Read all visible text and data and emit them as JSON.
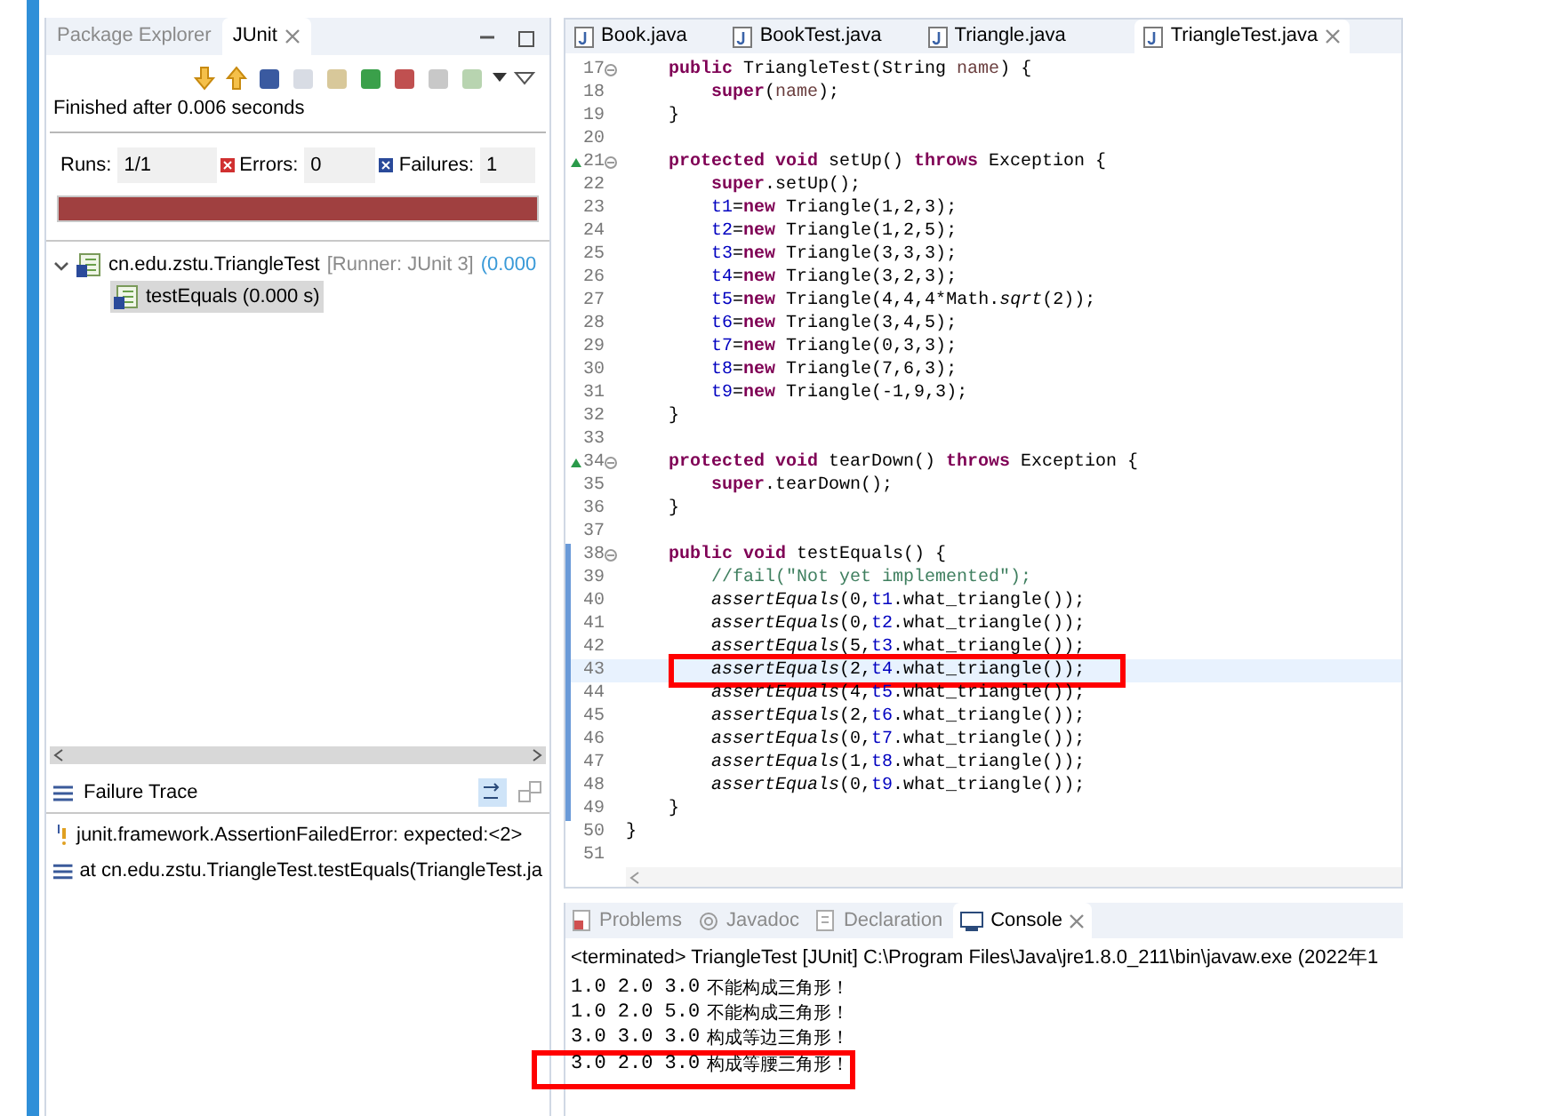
{
  "junit_view": {
    "tabs": [
      {
        "label": "Package Explorer",
        "selected": false
      },
      {
        "label": "JUnit",
        "selected": true
      }
    ],
    "status": "Finished after 0.006 seconds",
    "counters": [
      {
        "label": "Runs:",
        "value": "1/1",
        "kind": "runs"
      },
      {
        "label": "Errors:",
        "value": "0",
        "kind": "errors"
      },
      {
        "label": "Failures:",
        "value": "1",
        "kind": "failures"
      }
    ],
    "progress": {
      "level": 1,
      "failed": true
    },
    "tree": [
      {
        "label": "cn.edu.zstu.TriangleTest",
        "runner": "[Runner: JUnit 3]",
        "time": "(0.000",
        "expanded": true,
        "selected": false,
        "children": [
          {
            "label": "testEquals (0.000 s)",
            "selected": true
          }
        ]
      }
    ],
    "failure_trace": {
      "title": "Failure Trace",
      "lines": [
        {
          "kind": "error",
          "text": "junit.framework.AssertionFailedError: expected:<2>"
        },
        {
          "kind": "stack",
          "text": "at cn.edu.zstu.TriangleTest.testEquals(TriangleTest.ja"
        }
      ]
    }
  },
  "editor": {
    "tabs": [
      {
        "label": "Book.java",
        "selected": false
      },
      {
        "label": "BookTest.java",
        "selected": false
      },
      {
        "label": "Triangle.java",
        "selected": false
      },
      {
        "label": "TriangleTest.java",
        "selected": true
      }
    ],
    "class_body": [
      {
        "no": "17",
        "fold": true,
        "override": false,
        "changed": false,
        "current": false,
        "segs": [
          {
            "kind": "keyword",
            "text": "public"
          },
          {
            "kind": "plain",
            "text": " TriangleTest(String "
          },
          {
            "kind": "param",
            "text": "name"
          },
          {
            "kind": "plain",
            "text": ") {"
          }
        ],
        "children": [
          {
            "no": "18",
            "fold": false,
            "override": false,
            "changed": false,
            "current": false,
            "segs": [
              {
                "kind": "keyword",
                "text": "super"
              },
              {
                "kind": "plain",
                "text": "("
              },
              {
                "kind": "param",
                "text": "name"
              },
              {
                "kind": "plain",
                "text": ");"
              }
            ]
          }
        ]
      },
      {
        "no": "19",
        "fold": false,
        "override": false,
        "changed": false,
        "current": false,
        "segs": [
          {
            "kind": "plain",
            "text": "}"
          }
        ]
      },
      {
        "no": "20",
        "fold": false,
        "override": false,
        "changed": false,
        "current": false
      },
      {
        "no": "21",
        "fold": true,
        "override": true,
        "changed": false,
        "current": false,
        "segs": [
          {
            "kind": "keyword",
            "text": "protected void"
          },
          {
            "kind": "plain",
            "text": " setUp() "
          },
          {
            "kind": "keyword",
            "text": "throws"
          },
          {
            "kind": "plain",
            "text": " Exception {"
          }
        ],
        "children": [
          {
            "no": "22",
            "fold": false,
            "override": false,
            "changed": false,
            "current": false,
            "segs": [
              {
                "kind": "keyword",
                "text": "super"
              },
              {
                "kind": "plain",
                "text": ".setUp();"
              }
            ]
          },
          {
            "no": "23",
            "fold": false,
            "override": false,
            "changed": false,
            "current": false,
            "segs": [
              {
                "kind": "field",
                "text": "t1"
              },
              {
                "kind": "plain",
                "text": "="
              },
              {
                "kind": "keyword",
                "text": "new"
              },
              {
                "kind": "plain",
                "text": " Triangle(1,2,3);"
              }
            ]
          },
          {
            "no": "24",
            "fold": false,
            "override": false,
            "changed": false,
            "current": false,
            "segs": [
              {
                "kind": "field",
                "text": "t2"
              },
              {
                "kind": "plain",
                "text": "="
              },
              {
                "kind": "keyword",
                "text": "new"
              },
              {
                "kind": "plain",
                "text": " Triangle(1,2,5);"
              }
            ]
          },
          {
            "no": "25",
            "fold": false,
            "override": false,
            "changed": false,
            "current": false,
            "segs": [
              {
                "kind": "field",
                "text": "t3"
              },
              {
                "kind": "plain",
                "text": "="
              },
              {
                "kind": "keyword",
                "text": "new"
              },
              {
                "kind": "plain",
                "text": " Triangle(3,3,3);"
              }
            ]
          },
          {
            "no": "26",
            "fold": false,
            "override": false,
            "changed": false,
            "current": false,
            "segs": [
              {
                "kind": "field",
                "text": "t4"
              },
              {
                "kind": "plain",
                "text": "="
              },
              {
                "kind": "keyword",
                "text": "new"
              },
              {
                "kind": "plain",
                "text": " Triangle(3,2,3);"
              }
            ]
          },
          {
            "no": "27",
            "fold": false,
            "override": false,
            "changed": false,
            "current": false,
            "segs": [
              {
                "kind": "field",
                "text": "t5"
              },
              {
                "kind": "plain",
                "text": "="
              },
              {
                "kind": "keyword",
                "text": "new"
              },
              {
                "kind": "plain",
                "text": " Triangle(4,4,4*Math."
              },
              {
                "kind": "italic",
                "text": "sqrt"
              },
              {
                "kind": "plain",
                "text": "(2));"
              }
            ]
          },
          {
            "no": "28",
            "fold": false,
            "override": false,
            "changed": false,
            "current": false,
            "segs": [
              {
                "kind": "field",
                "text": "t6"
              },
              {
                "kind": "plain",
                "text": "="
              },
              {
                "kind": "keyword",
                "text": "new"
              },
              {
                "kind": "plain",
                "text": " Triangle(3,4,5);"
              }
            ]
          },
          {
            "no": "29",
            "fold": false,
            "override": false,
            "changed": false,
            "current": false,
            "segs": [
              {
                "kind": "field",
                "text": "t7"
              },
              {
                "kind": "plain",
                "text": "="
              },
              {
                "kind": "keyword",
                "text": "new"
              },
              {
                "kind": "plain",
                "text": " Triangle(0,3,3);"
              }
            ]
          },
          {
            "no": "30",
            "fold": false,
            "override": false,
            "changed": false,
            "current": false,
            "segs": [
              {
                "kind": "field",
                "text": "t8"
              },
              {
                "kind": "plain",
                "text": "="
              },
              {
                "kind": "keyword",
                "text": "new"
              },
              {
                "kind": "plain",
                "text": " Triangle(7,6,3);"
              }
            ]
          },
          {
            "no": "31",
            "fold": false,
            "override": false,
            "changed": false,
            "current": false,
            "segs": [
              {
                "kind": "field",
                "text": "t9"
              },
              {
                "kind": "plain",
                "text": "="
              },
              {
                "kind": "keyword",
                "text": "new"
              },
              {
                "kind": "plain",
                "text": " Triangle(-1,9,3);"
              }
            ]
          }
        ]
      },
      {
        "no": "32",
        "fold": false,
        "override": false,
        "changed": false,
        "current": false,
        "segs": [
          {
            "kind": "plain",
            "text": "}"
          }
        ]
      },
      {
        "no": "33",
        "fold": false,
        "override": false,
        "changed": false,
        "current": false
      },
      {
        "no": "34",
        "fold": true,
        "override": true,
        "changed": false,
        "current": false,
        "segs": [
          {
            "kind": "keyword",
            "text": "protected void"
          },
          {
            "kind": "plain",
            "text": " tearDown() "
          },
          {
            "kind": "keyword",
            "text": "throws"
          },
          {
            "kind": "plain",
            "text": " Exception {"
          }
        ],
        "children": [
          {
            "no": "35",
            "fold": false,
            "override": false,
            "changed": false,
            "current": false,
            "segs": [
              {
                "kind": "keyword",
                "text": "super"
              },
              {
                "kind": "plain",
                "text": ".tearDown();"
              }
            ]
          }
        ]
      },
      {
        "no": "36",
        "fold": false,
        "override": false,
        "changed": false,
        "current": false,
        "segs": [
          {
            "kind": "plain",
            "text": "}"
          }
        ]
      },
      {
        "no": "37",
        "fold": false,
        "override": false,
        "changed": false,
        "current": false
      },
      {
        "no": "38",
        "fold": true,
        "override": false,
        "changed": true,
        "current": false,
        "segs": [
          {
            "kind": "keyword",
            "text": "public void"
          },
          {
            "kind": "plain",
            "text": " testEquals() {"
          }
        ],
        "children": [
          {
            "no": "39",
            "fold": false,
            "override": false,
            "changed": true,
            "current": false,
            "segs": [
              {
                "kind": "comment",
                "text": "//fail(\"Not yet implemented\");"
              }
            ]
          },
          {
            "no": "40",
            "fold": false,
            "override": false,
            "changed": true,
            "current": false,
            "segs": [
              {
                "kind": "italic",
                "text": "assertEquals"
              },
              {
                "kind": "plain",
                "text": "(0,"
              },
              {
                "kind": "field",
                "text": "t1"
              },
              {
                "kind": "plain",
                "text": ".what_triangle());"
              }
            ]
          },
          {
            "no": "41",
            "fold": false,
            "override": false,
            "changed": true,
            "current": false,
            "segs": [
              {
                "kind": "italic",
                "text": "assertEquals"
              },
              {
                "kind": "plain",
                "text": "(0,"
              },
              {
                "kind": "field",
                "text": "t2"
              },
              {
                "kind": "plain",
                "text": ".what_triangle());"
              }
            ]
          },
          {
            "no": "42",
            "fold": false,
            "override": false,
            "changed": true,
            "current": false,
            "segs": [
              {
                "kind": "italic",
                "text": "assertEquals"
              },
              {
                "kind": "plain",
                "text": "(5,"
              },
              {
                "kind": "field",
                "text": "t3"
              },
              {
                "kind": "plain",
                "text": ".what_triangle());"
              }
            ]
          },
          {
            "no": "43",
            "fold": false,
            "override": false,
            "changed": true,
            "current": true,
            "segs": [
              {
                "kind": "italic",
                "text": "assertEquals"
              },
              {
                "kind": "plain",
                "text": "(2,"
              },
              {
                "kind": "field",
                "text": "t4"
              },
              {
                "kind": "plain",
                "text": ".what_triangle());"
              }
            ]
          },
          {
            "no": "44",
            "fold": false,
            "override": false,
            "changed": true,
            "current": false,
            "segs": [
              {
                "kind": "italic",
                "text": "assertEquals"
              },
              {
                "kind": "plain",
                "text": "(4,"
              },
              {
                "kind": "field",
                "text": "t5"
              },
              {
                "kind": "plain",
                "text": ".what_triangle());"
              }
            ]
          },
          {
            "no": "45",
            "fold": false,
            "override": false,
            "changed": true,
            "current": false,
            "segs": [
              {
                "kind": "italic",
                "text": "assertEquals"
              },
              {
                "kind": "plain",
                "text": "(2,"
              },
              {
                "kind": "field",
                "text": "t6"
              },
              {
                "kind": "plain",
                "text": ".what_triangle());"
              }
            ]
          },
          {
            "no": "46",
            "fold": false,
            "override": false,
            "changed": true,
            "current": false,
            "segs": [
              {
                "kind": "italic",
                "text": "assertEquals"
              },
              {
                "kind": "plain",
                "text": "(0,"
              },
              {
                "kind": "field",
                "text": "t7"
              },
              {
                "kind": "plain",
                "text": ".what_triangle());"
              }
            ]
          },
          {
            "no": "47",
            "fold": false,
            "override": false,
            "changed": true,
            "current": false,
            "segs": [
              {
                "kind": "italic",
                "text": "assertEquals"
              },
              {
                "kind": "plain",
                "text": "(1,"
              },
              {
                "kind": "field",
                "text": "t8"
              },
              {
                "kind": "plain",
                "text": ".what_triangle());"
              }
            ]
          },
          {
            "no": "48",
            "fold": false,
            "override": false,
            "changed": true,
            "current": false,
            "segs": [
              {
                "kind": "italic",
                "text": "assertEquals"
              },
              {
                "kind": "plain",
                "text": "(0,"
              },
              {
                "kind": "field",
                "text": "t9"
              },
              {
                "kind": "plain",
                "text": ".what_triangle());"
              }
            ]
          }
        ]
      },
      {
        "no": "49",
        "fold": false,
        "override": false,
        "changed": true,
        "current": false,
        "segs": [
          {
            "kind": "plain",
            "text": "}"
          }
        ]
      }
    ],
    "trailing_lines": [
      {
        "no": "50",
        "fold": false,
        "override": false,
        "changed": false,
        "current": false,
        "segs": [
          {
            "kind": "plain",
            "text": "}"
          }
        ]
      },
      {
        "no": "51",
        "fold": false,
        "override": false,
        "changed": false,
        "current": false
      }
    ]
  },
  "console_view": {
    "tabs": [
      {
        "label": "Problems",
        "selected": false,
        "kind": "problems"
      },
      {
        "label": "Javadoc",
        "selected": false,
        "kind": "javadoc"
      },
      {
        "label": "Declaration",
        "selected": false,
        "kind": "declaration"
      },
      {
        "label": "Console",
        "selected": true,
        "kind": "console"
      }
    ],
    "header": "<terminated> TriangleTest [JUnit] C:\\Program Files\\Java\\jre1.8.0_211\\bin\\javaw.exe (2022年1",
    "lines": [
      {
        "values": "1.0 2.0 3.0",
        "message": "不能构成三角形！",
        "marked": false
      },
      {
        "values": "1.0 2.0 5.0",
        "message": "不能构成三角形！",
        "marked": false
      },
      {
        "values": "3.0 3.0 3.0",
        "message": "构成等边三角形！",
        "marked": false
      },
      {
        "values": "3.0 2.0 3.0",
        "message": "构成等腰三角形！",
        "marked": true
      }
    ]
  }
}
